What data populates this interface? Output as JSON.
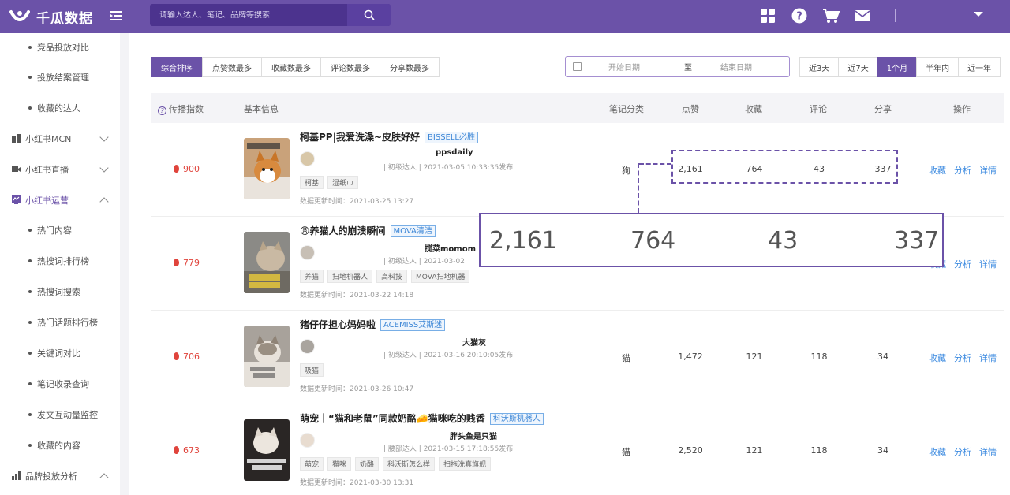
{
  "header": {
    "logo_text": "千瓜数据",
    "search_placeholder": "请输入达人、笔记、品牌等搜索"
  },
  "sidebar": {
    "items": [
      {
        "label": "竞品投放对比",
        "type": "sub"
      },
      {
        "label": "投放结案管理",
        "type": "sub"
      },
      {
        "label": "收藏的达人",
        "type": "sub"
      },
      {
        "label": "小红书MCN",
        "type": "group"
      },
      {
        "label": "小红书直播",
        "type": "group"
      },
      {
        "label": "小红书运营",
        "type": "group"
      },
      {
        "label": "热门内容",
        "type": "sub"
      },
      {
        "label": "热搜词排行榜",
        "type": "sub"
      },
      {
        "label": "热搜词搜索",
        "type": "sub"
      },
      {
        "label": "热门话题排行榜",
        "type": "sub"
      },
      {
        "label": "关键词对比",
        "type": "sub"
      },
      {
        "label": "笔记收录查询",
        "type": "sub"
      },
      {
        "label": "发文互动量监控",
        "type": "sub"
      },
      {
        "label": "收藏的内容",
        "type": "sub"
      },
      {
        "label": "品牌投放分析",
        "type": "group"
      }
    ]
  },
  "sort_tabs": [
    "综合排序",
    "点赞数最多",
    "收藏数最多",
    "评论数最多",
    "分享数最多"
  ],
  "date_range": {
    "start": "开始日期",
    "to": "至",
    "end": "结束日期"
  },
  "period_tabs": [
    "近3天",
    "近7天",
    "1个月",
    "半年内",
    "近一年"
  ],
  "table_headers": {
    "index": "传播指数",
    "info": "基本信息",
    "category": "笔记分类",
    "likes": "点赞",
    "favorites": "收藏",
    "comments": "评论",
    "shares": "分享",
    "actions": "操作"
  },
  "rows": [
    {
      "score": "900",
      "title": "柯基PP|我爱洗澡~皮肤好好",
      "brand": "BISSELL必胜",
      "author": "ppsdaily",
      "meta": "| 初级达人 | 2021-03-05 10:33:35发布",
      "tags": [
        "柯基",
        "湿纸巾"
      ],
      "updated": "数据更新时间：2021-03-25 13:27",
      "category": "狗",
      "likes": "2,161",
      "favorites": "764",
      "comments": "43",
      "shares": "337"
    },
    {
      "score": "779",
      "title": "😩养猫人的崩溃瞬间",
      "brand": "MOVA清洁",
      "author": "搅菜momom",
      "meta": "| 初级达人 | 2021-03-02",
      "tags": [
        "养猫",
        "扫地机器人",
        "高科技",
        "MOVA扫地机器"
      ],
      "updated": "数据更新时间：2021-03-22 14:18",
      "category": "",
      "likes": "",
      "favorites": "",
      "comments": "",
      "shares": ""
    },
    {
      "score": "706",
      "title": "猪仔仔担心妈妈啦",
      "brand": "ACEMISS艾斯迷",
      "author": "大猫灰",
      "meta": "| 初级达人 | 2021-03-16 20:10:05发布",
      "tags": [
        "吸猫"
      ],
      "updated": "数据更新时间：2021-03-26 10:47",
      "category": "猫",
      "likes": "1,472",
      "favorites": "121",
      "comments": "118",
      "shares": "34"
    },
    {
      "score": "673",
      "title": "萌宠｜“猫和老鼠”同款奶酪🧀猫咪吃的贱香",
      "brand": "科沃斯机器人",
      "author": "胖头鱼是只猫",
      "meta": "| 腰部达人 | 2021-03-15 17:18:55发布",
      "tags": [
        "萌宠",
        "猫咪",
        "奶酪",
        "科沃斯怎么样",
        "扫拖洗真旗舰"
      ],
      "updated": "数据更新时间：2021-03-30 13:31",
      "category": "猫",
      "likes": "2,520",
      "favorites": "121",
      "comments": "118",
      "shares": "34"
    }
  ],
  "actions": {
    "favorite": "收藏",
    "analyze": "分析",
    "detail": "详情"
  },
  "zoom": {
    "likes": "2,161",
    "favorites": "764",
    "comments": "43",
    "shares": "337"
  },
  "colors": {
    "brand": "#6b52a8",
    "link": "#3d8be0",
    "hot": "#e0443c"
  }
}
